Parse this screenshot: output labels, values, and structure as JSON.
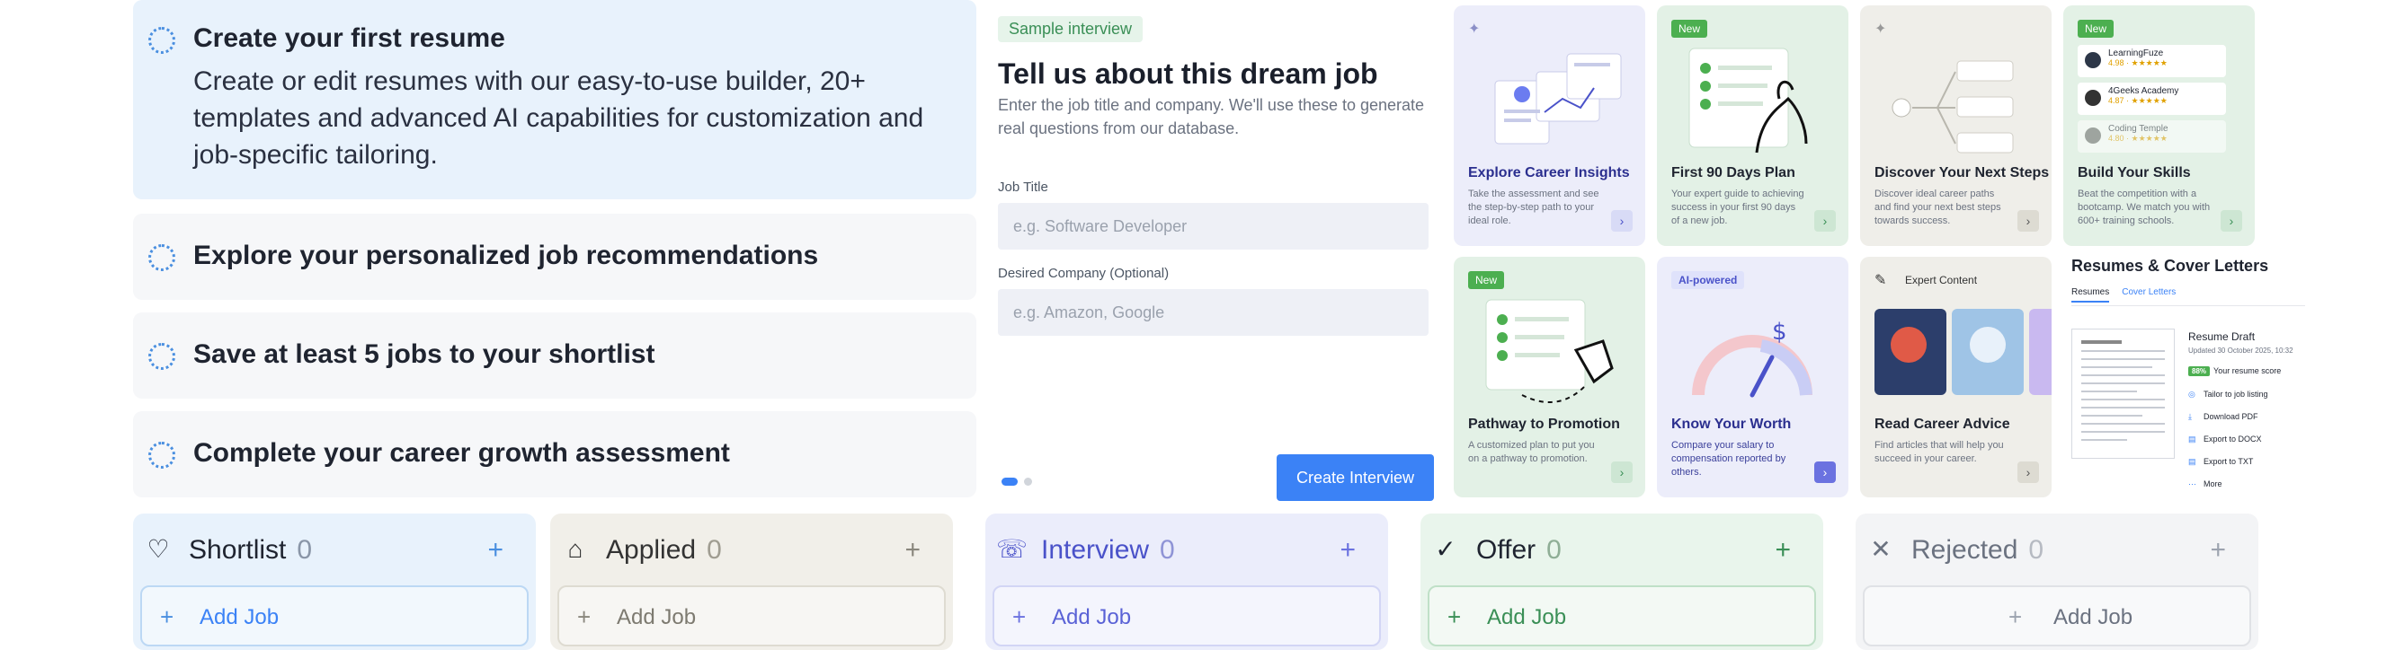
{
  "checklist": {
    "steps": [
      {
        "title": "Create your first resume",
        "description": "Create or edit resumes with our easy-to-use builder, 20+ templates and advanced AI capabilities for customization and job-specific tailoring."
      },
      {
        "title": "Explore your personalized job recommendations"
      },
      {
        "title": "Save at least 5 jobs to your shortlist"
      },
      {
        "title": "Complete your career growth assessment"
      }
    ]
  },
  "interview": {
    "tag": "Sample interview",
    "title": "Tell us about this dream job",
    "description": "Enter the job title and company. We'll use these to generate real questions from our database.",
    "job_title_label": "Job Title",
    "job_title_placeholder": "e.g. Software Developer",
    "company_label": "Desired Company (Optional)",
    "company_placeholder": "e.g. Amazon, Google",
    "create_button": "Create Interview"
  },
  "cards": [
    {
      "title": "Explore Career Insights",
      "description": "Take the assessment and see the step-by-step path to your ideal role.",
      "badge": ""
    },
    {
      "title": "First 90 Days Plan",
      "description": "Your expert guide to achieving success in your first 90 days of a new job.",
      "badge": "New"
    },
    {
      "title": "Discover Your Next Steps",
      "description": "Discover ideal career paths and find your next best steps towards success.",
      "badge": ""
    },
    {
      "title": "Build Your Skills",
      "description": "Beat the competition with a bootcamp. We match you with 600+ training schools.",
      "badge": "New",
      "schools": [
        {
          "name": "LearningFuze",
          "rating": "4.98 · ★★★★★"
        },
        {
          "name": "4Geeks Academy",
          "rating": "4.87 · ★★★★★"
        },
        {
          "name": "Coding Temple",
          "rating": "4.80 · ★★★★★"
        }
      ]
    },
    {
      "title": "Pathway to Promotion",
      "description": "A customized plan to put you on a pathway to promotion.",
      "badge": "New"
    },
    {
      "title": "Know Your Worth",
      "description": "Compare your salary to compensation reported by others.",
      "badge": "AI-powered"
    },
    {
      "title": "Read Career Advice",
      "description": "Find articles that will help you succeed in your career.",
      "badge": "Expert Content"
    }
  ],
  "resumes": {
    "title": "Resumes & Cover Letters",
    "tabs": [
      "Resumes",
      "Cover Letters"
    ],
    "doc_title": "Resume Draft",
    "doc_date": "Updated 30 October 2025, 10:32",
    "score_badge": "88%",
    "score_label": "Your resume score",
    "actions": [
      "Tailor to job listing",
      "Download PDF",
      "Export to DOCX",
      "Export to TXT",
      "More"
    ]
  },
  "pipeline": {
    "columns": [
      {
        "name": "Shortlist",
        "count": "0",
        "add_label": "Add Job",
        "color": "#e8f2fc"
      },
      {
        "name": "Applied",
        "count": "0",
        "add_label": "Add Job",
        "color": "#f1efe9"
      },
      {
        "name": "Interview",
        "count": "0",
        "add_label": "Add Job",
        "color": "#ebedfb"
      },
      {
        "name": "Offer",
        "count": "0",
        "add_label": "Add Job",
        "color": "#e9f5ec"
      },
      {
        "name": "Rejected",
        "count": "0",
        "add_label": "Add Job",
        "color": "#f3f4f6"
      }
    ]
  },
  "icons": {
    "step_ring": "dotted-circle-icon",
    "shortlist": "heart-icon",
    "applied": "briefcase-icon",
    "interview": "person-chat-icon",
    "offer": "check-circle-icon",
    "rejected": "x-icon",
    "add": "plus-icon"
  },
  "colors": {
    "accent": "#3b82f6",
    "new_badge": "#4caf50"
  }
}
